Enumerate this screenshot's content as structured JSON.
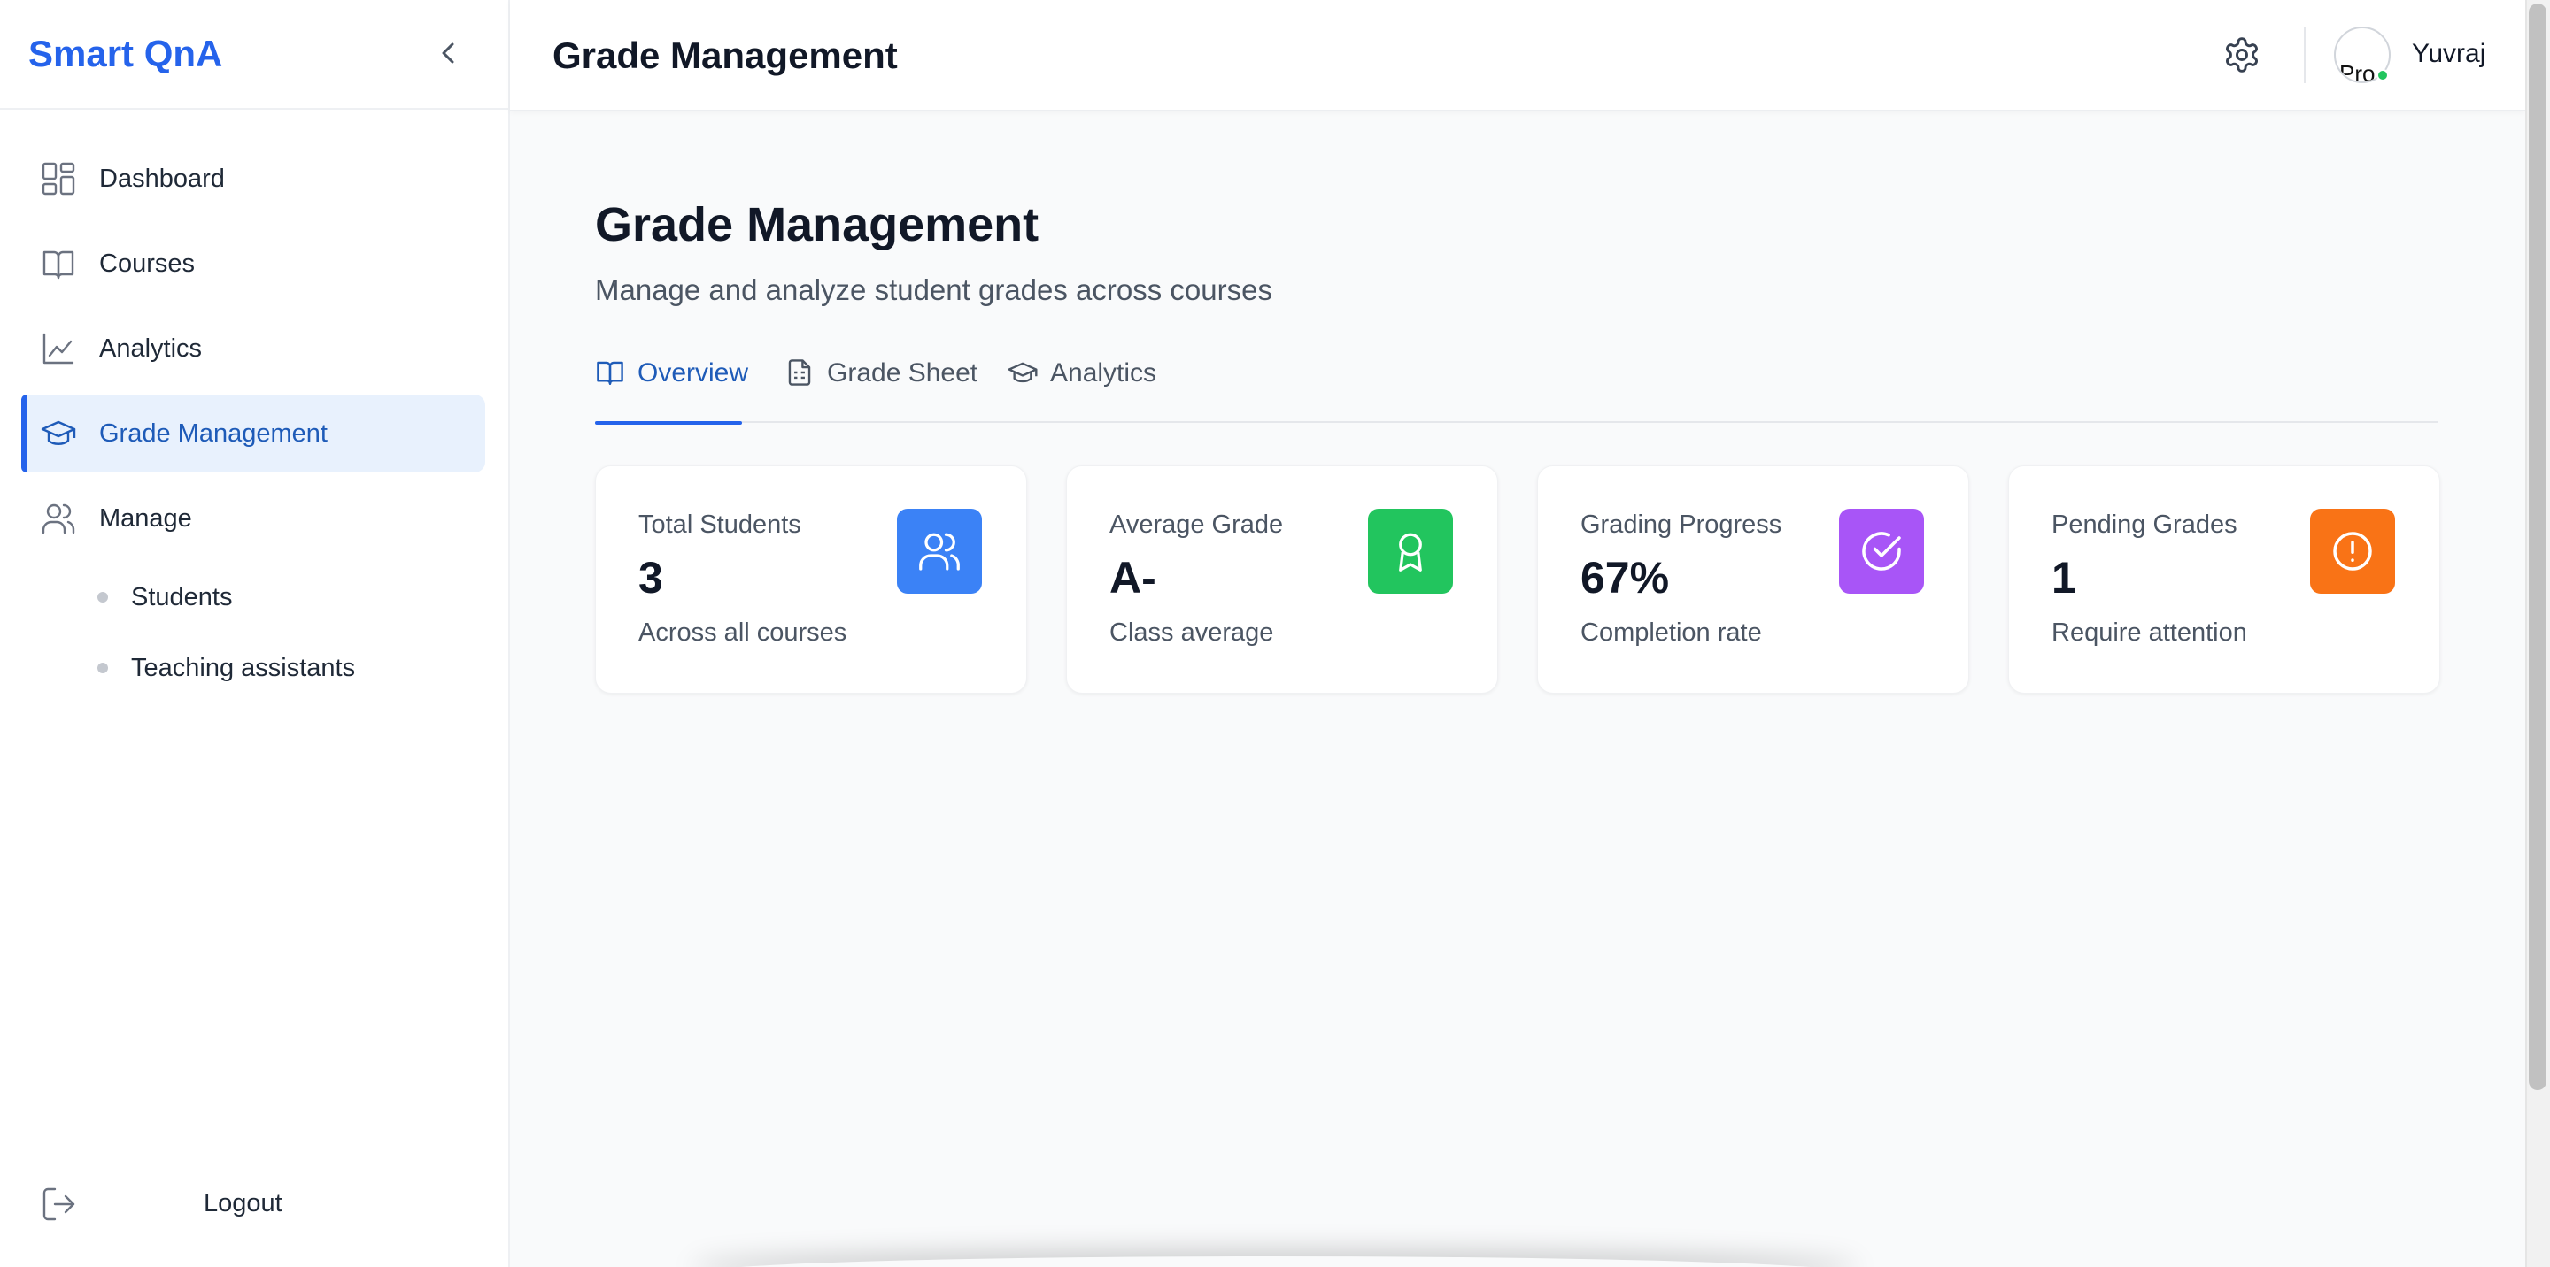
{
  "app": {
    "brand": "Smart QnA"
  },
  "sidebar": {
    "items": [
      {
        "label": "Dashboard",
        "icon": "dashboard-icon"
      },
      {
        "label": "Courses",
        "icon": "book-icon"
      },
      {
        "label": "Analytics",
        "icon": "chart-line-icon"
      },
      {
        "label": "Grade Management",
        "icon": "graduation-cap-icon",
        "active": true
      },
      {
        "label": "Manage",
        "icon": "users-icon"
      }
    ],
    "sub_items": [
      {
        "label": "Students"
      },
      {
        "label": "Teaching assistants"
      }
    ],
    "logout": "Logout"
  },
  "header": {
    "title": "Grade Management",
    "user": {
      "name": "Yuvraj",
      "avatar_alt": "Pro"
    }
  },
  "main": {
    "title": "Grade Management",
    "subtitle": "Manage and analyze student grades across courses",
    "tabs": [
      {
        "label": "Overview",
        "icon": "book-open-icon",
        "active": true
      },
      {
        "label": "Grade Sheet",
        "icon": "file-text-icon"
      },
      {
        "label": "Analytics",
        "icon": "graduation-cap-icon"
      }
    ],
    "cards": [
      {
        "label": "Total Students",
        "value": "3",
        "desc": "Across all courses",
        "icon": "users-icon",
        "color": "#3b82f6"
      },
      {
        "label": "Average Grade",
        "value": "A-",
        "desc": "Class average",
        "icon": "award-icon",
        "color": "#22c55e"
      },
      {
        "label": "Grading Progress",
        "value": "67%",
        "desc": "Completion rate",
        "icon": "check-circle-icon",
        "color": "#a855f7"
      },
      {
        "label": "Pending Grades",
        "value": "1",
        "desc": "Require attention",
        "icon": "alert-circle-icon",
        "color": "#f97316"
      }
    ]
  },
  "colors": {
    "accent": "#2563eb",
    "active_bg": "#e8f1fd"
  }
}
